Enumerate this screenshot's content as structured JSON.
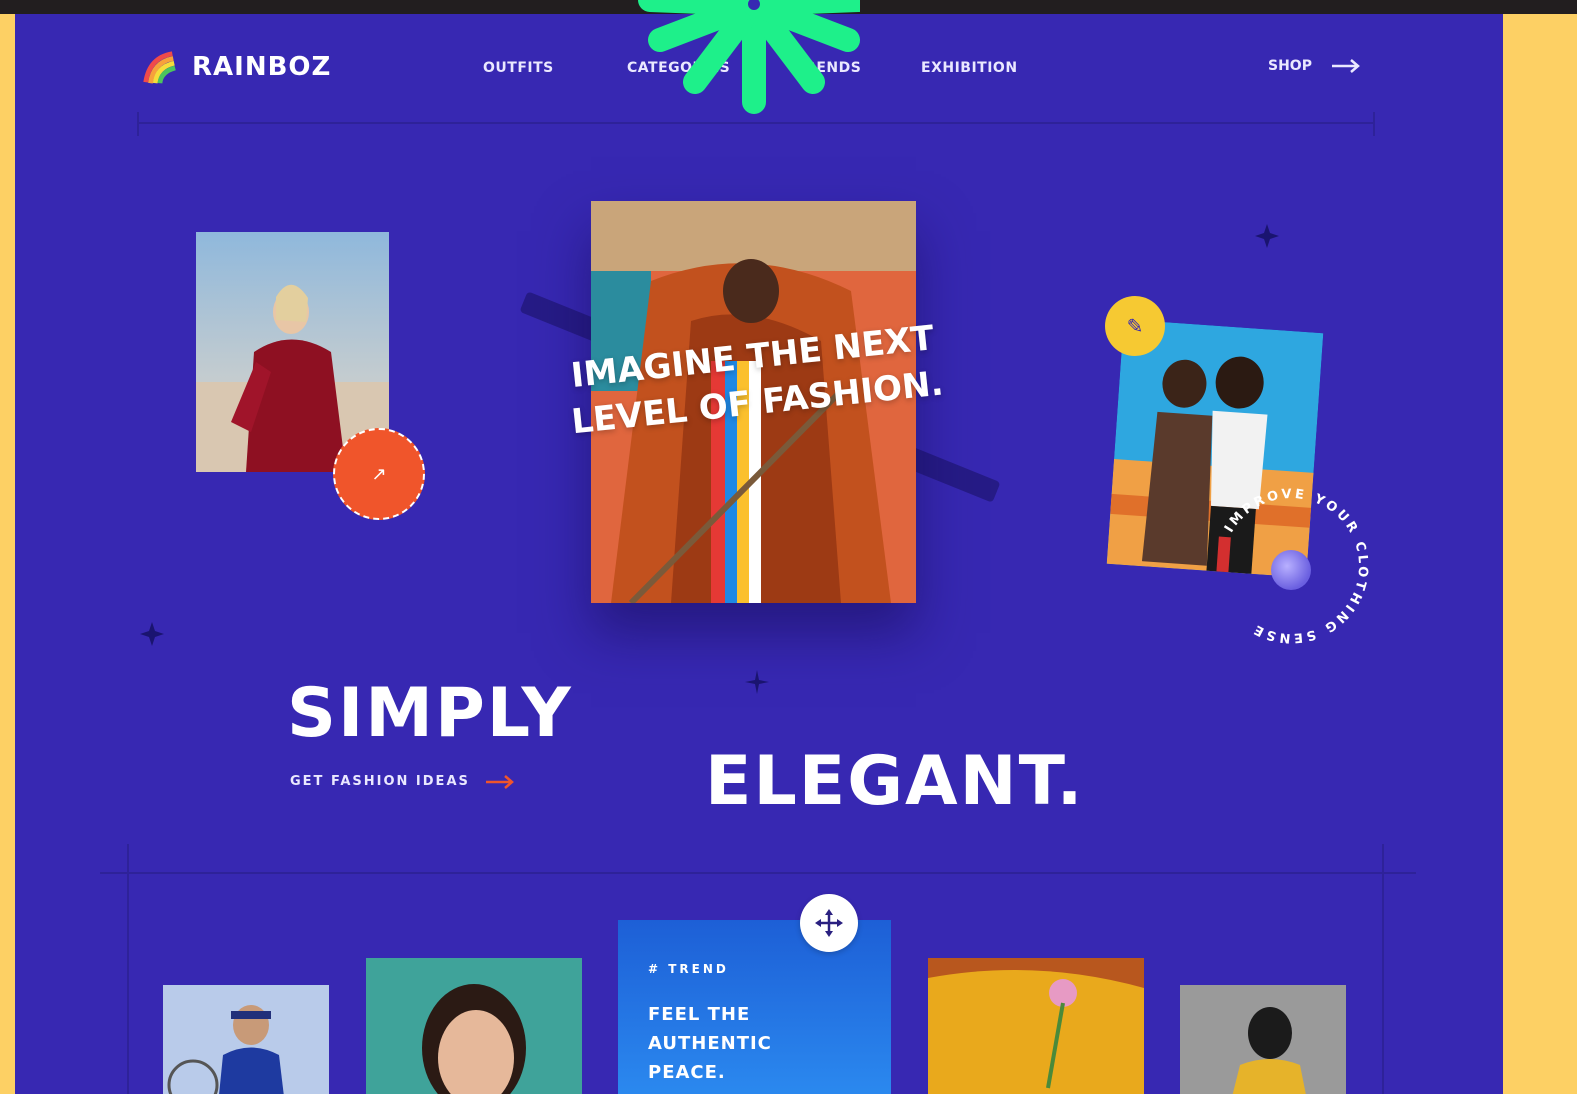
{
  "brand": {
    "name": "RAINBOZ",
    "icon": "rainbow-icon"
  },
  "nav": {
    "items": [
      "OUTFITS",
      "CATEGORIES",
      "TRENDS",
      "EXHIBITION"
    ],
    "shop_label": "SHOP",
    "shop_icon": "arrow-right-icon"
  },
  "hero": {
    "tagline": "IMAGINE THE NEXT LEVEL OF FASHION.",
    "badge_icon": "arrow-up-right-icon",
    "circle_text": "IMPROVE YOUR CLOTHING SENSE",
    "headline_1": "SIMPLY",
    "headline_2": "ELEGANT.",
    "cta_label": "GET FASHION IDEAS",
    "cta_icon": "arrow-right-icon"
  },
  "trend_card": {
    "tag": "# TREND",
    "title_lines": [
      "FEEL THE",
      "AUTHENTIC",
      "PEACE."
    ]
  },
  "colors": {
    "page_background": "#fdd064",
    "stage": "#3728b2",
    "accent_green": "#1ef08a",
    "accent_orange": "#f0552b",
    "accent_yellow": "#f6c932",
    "trend_blue": "#2b8af0"
  }
}
